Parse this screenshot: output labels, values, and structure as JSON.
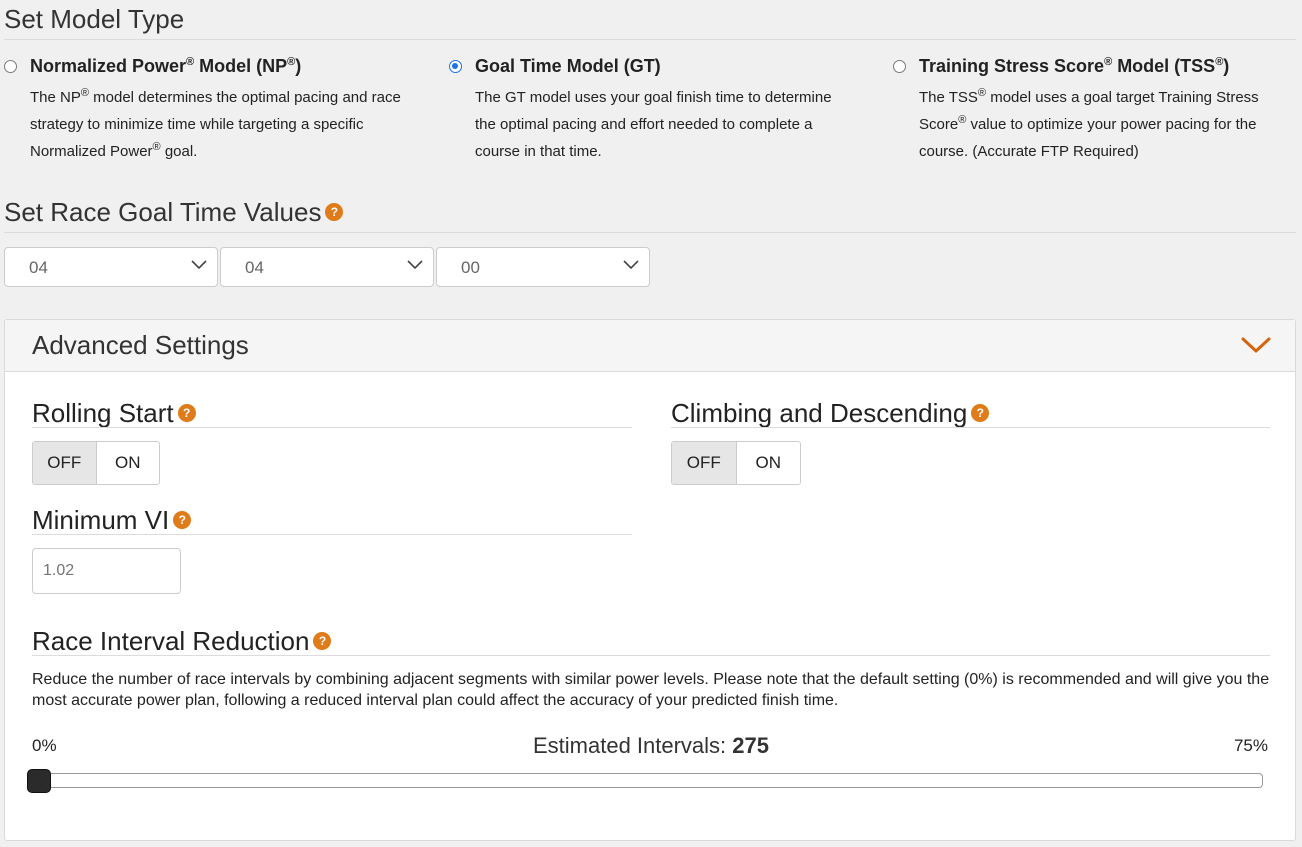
{
  "model_section": {
    "title": "Set Model Type",
    "options": [
      {
        "title_parts": [
          "Normalized Power",
          "®",
          " Model (NP",
          "®",
          ")"
        ],
        "desc_parts": [
          "The NP",
          "®",
          " model determines the optimal pacing and race strategy to minimize time while targeting a specific Normalized Power",
          "®",
          " goal."
        ],
        "selected": false
      },
      {
        "title_parts": [
          "Goal Time Model (GT)",
          "",
          "",
          "",
          ""
        ],
        "desc_parts": [
          "The GT model uses your goal finish time to determine the optimal pacing and effort needed to complete a course in that time.",
          "",
          "",
          "",
          ""
        ],
        "selected": true
      },
      {
        "title_parts": [
          "Training Stress Score",
          "®",
          " Model (TSS",
          "®",
          ")"
        ],
        "desc_parts": [
          "The TSS",
          "®",
          " model uses a goal target Training Stress Score",
          "®",
          " value to optimize your power pacing for the course. (Accurate FTP Required)"
        ],
        "selected": false
      }
    ]
  },
  "goal_time": {
    "title": "Set Race Goal Time Values",
    "help": "?",
    "hours": "04",
    "minutes": "04",
    "seconds": "00"
  },
  "advanced": {
    "title": "Advanced Settings",
    "rolling_start": {
      "title": "Rolling Start",
      "help": "?",
      "off": "OFF",
      "on": "ON",
      "value": "OFF"
    },
    "climbing": {
      "title": "Climbing and Descending",
      "help": "?",
      "off": "OFF",
      "on": "ON",
      "value": "OFF"
    },
    "min_vi": {
      "title": "Minimum VI",
      "help": "?",
      "placeholder": "1.02"
    },
    "interval_reduction": {
      "title": "Race Interval Reduction",
      "help": "?",
      "description": "Reduce the number of race intervals by combining adjacent segments with similar power levels. Please note that the default setting (0%) is recommended and will give you the most accurate power plan, following a reduced interval plan could affect the accuracy of your predicted finish time.",
      "min_label": "0%",
      "max_label": "75%",
      "estimated_label": "Estimated Intervals: ",
      "estimated_value": "275",
      "slider_fraction": 0
    }
  },
  "colors": {
    "accent": "#e07b1a",
    "radio": "#1a73e8"
  }
}
